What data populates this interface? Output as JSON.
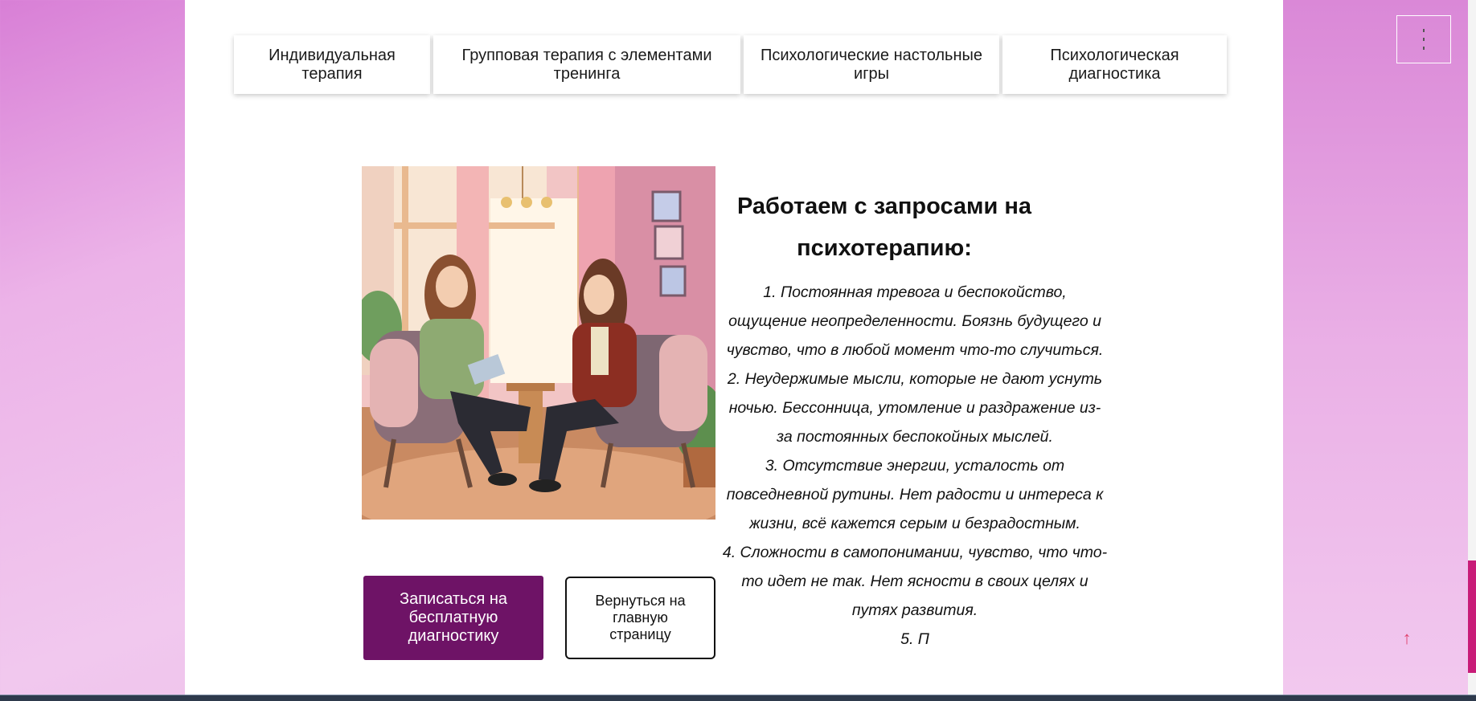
{
  "tabs": [
    {
      "label": "Индивидуальная терапия"
    },
    {
      "label": "Групповая терапия с элементами тренинга"
    },
    {
      "label": "Психологические настольные игры"
    },
    {
      "label": "Психологическая диагностика"
    }
  ],
  "section": {
    "heading": "Работаем с запросами на психотерапию:",
    "items": [
      "1. Постоянная тревога и беспокойство, ощущение неопределенности. Боязнь будущего и чувство, что в любой момент что-то случиться.",
      "2. Неудержимые мысли, которые не дают уснуть ночью. Бессонница, утомление и раздражение из-за постоянных беспокойных мыслей.",
      "3. Отсутствие энергии, усталость от повседневной рутины. Нет радости и интереса к жизни, всё кажется серым и безрадостным.",
      "4. Сложности в самопонимании, чувство, что что-то идет не так. Нет ясности в своих целях и путях развития.",
      "5. П"
    ]
  },
  "buttons": {
    "signup": "Записаться на бесплатную диагностику",
    "back": "Вернуться на главную страницу"
  },
  "icons": {
    "menu": "vertical-dots-icon",
    "scroll_top": "arrow-up-icon",
    "scroll_top_glyph": "↑"
  },
  "colors": {
    "accent": "#6e1366",
    "arrow": "#e0436e",
    "background_gradient_start": "#d87fd6"
  }
}
